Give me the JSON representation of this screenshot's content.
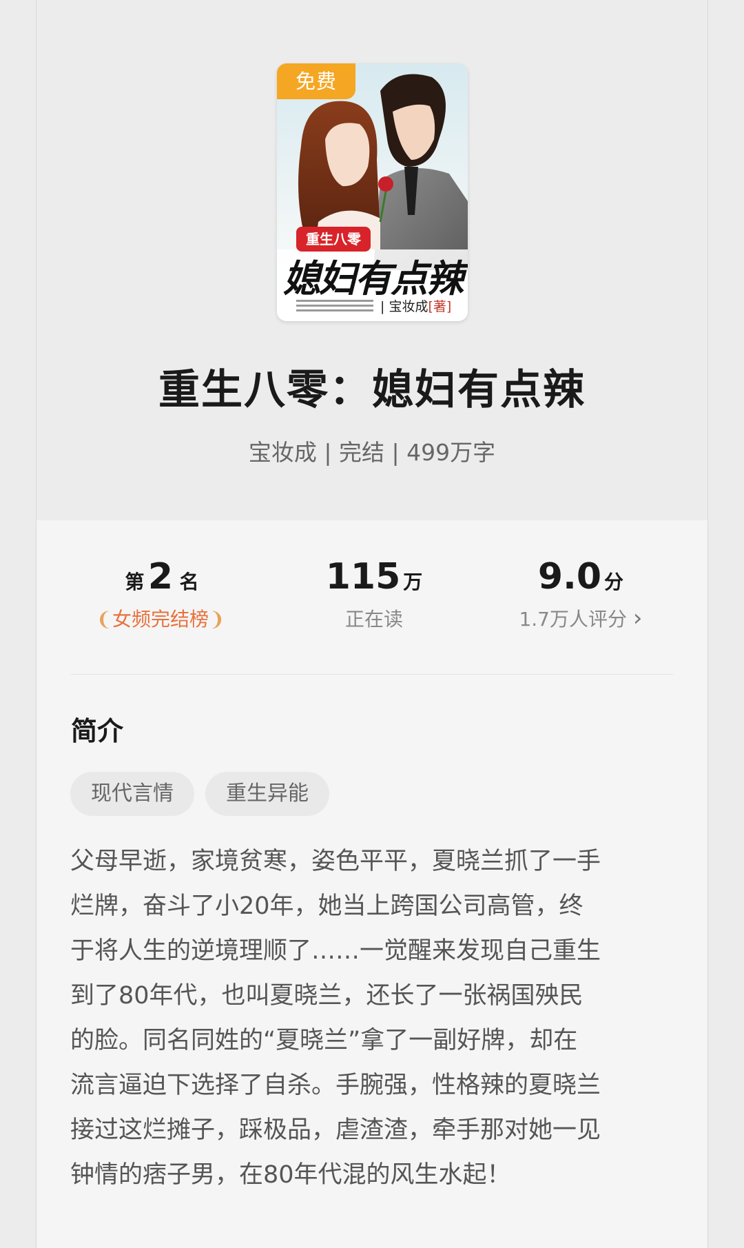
{
  "cover": {
    "badge": "免费",
    "subtitle": "重生八零",
    "title": "媳妇有点辣",
    "author": "宝妆成",
    "author_suffix": "著"
  },
  "book": {
    "title": "重生八零：媳妇有点辣",
    "meta": "宝妆成 | 完结 | 499万字"
  },
  "stats": {
    "rank": {
      "prefix": "第",
      "value": "2",
      "suffix": "名",
      "label": "女频完结榜"
    },
    "reading": {
      "value": "115",
      "unit": "万",
      "label": "正在读"
    },
    "score": {
      "value": "9.0",
      "unit": "分",
      "label": "1.7万人评分",
      "chevron": "›"
    }
  },
  "intro": {
    "heading": "简介",
    "tags": [
      "现代言情",
      "重生异能"
    ],
    "lines": [
      "父母早逝，家境贫寒，姿色平平，夏晓兰抓了一手",
      "烂牌，奋斗了小20年，她当上跨国公司高管，终",
      "于将人生的逆境理顺了……一觉醒来发现自己重生",
      "到了80年代，也叫夏晓兰，还长了一张祸国殃民",
      "的脸。同名同姓的“夏晓兰”拿了一副好牌，却在",
      "流言逼迫下选择了自杀。手腕强，性格辣的夏晓兰",
      "接过这烂摊子，踩极品，虐渣渣，牵手那对她一见",
      "钟情的痞子男，在80年代混的风生水起！"
    ]
  },
  "colors": {
    "badge": "#f5a623",
    "rank_label": "#e8713c",
    "subtitle_band": "#d8232a"
  }
}
